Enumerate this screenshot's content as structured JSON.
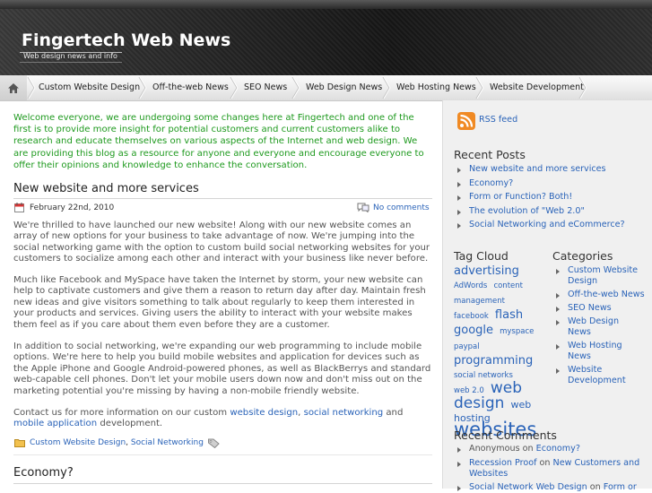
{
  "header": {
    "title": "Fingertech Web News",
    "tagline": "Web design news and info"
  },
  "nav": {
    "items": [
      {
        "label": "Custom Website Design"
      },
      {
        "label": "Off-the-web News"
      },
      {
        "label": "SEO News"
      },
      {
        "label": "Web Design News"
      },
      {
        "label": "Web Hosting News"
      },
      {
        "label": "Website Development"
      }
    ]
  },
  "intro": "Welcome everyone, we are undergoing some changes here at Fingertech and one of the first is to provide more insight for potential customers and current customers alike to research and educate themselves on various aspects of the Internet and web design. We are providing this blog as a resource for anyone and everyone and encourage everyone to offer their opinions and knowledge to enhance the conversation.",
  "posts": [
    {
      "title": "New website and more services",
      "date": "February 22nd, 2010",
      "comments": "No comments",
      "paragraphs": [
        "We're thrilled to have launched our new website! Along with our new website comes an array of new options for your business to take advantage of now. We're jumping into the social networking game with the option to custom build social networking websites for your customers to socialize among each other and interact with your business like never before.",
        "Much like Facebook and MySpace have taken the Internet by storm, your new website can help to captivate customers and give them a reason to return day after day. Maintain fresh new ideas and give visitors something to talk about regularly to keep them interested in your products and services. Giving users the ability to interact with your website makes them feel as if you care about them even before they are a customer.",
        "In addition to social networking, we're expanding our web programming to include mobile options. We're here to help you build mobile websites and application for devices such as the Apple iPhone and Google Android-powered phones, as well as BlackBerrys and standard web-capable cell phones. Don't let your mobile users down now and don't miss out on the marketing potential you're missing by having a non-mobile friendly website."
      ],
      "contact": {
        "before": "Contact us for more information on our custom ",
        "link1": "website design",
        "sep1": ", ",
        "link2": "social networking",
        "sep2": " and ",
        "link3": "mobile application",
        "after": " development."
      },
      "categories": [
        "Custom Website Design",
        "Social Networking"
      ],
      "cat_sep": ", "
    },
    {
      "title": "Economy?"
    }
  ],
  "sidebar": {
    "rss": "RSS feed",
    "recent_posts": {
      "heading": "Recent Posts",
      "items": [
        "New website and more services",
        "Economy?",
        "Form or Function? Both!",
        "The evolution of \"Web 2.0\"",
        "Social Networking and eCommerce?"
      ]
    },
    "tag_cloud": {
      "heading": "Tag Cloud",
      "tags": [
        {
          "label": "advertising",
          "size": 13
        },
        {
          "label": "AdWords",
          "size": 8.5
        },
        {
          "label": "content",
          "size": 8.5
        },
        {
          "label": "management",
          "size": 8.5
        },
        {
          "label": "facebook",
          "size": 8.5
        },
        {
          "label": "flash",
          "size": 13
        },
        {
          "label": "google",
          "size": 13
        },
        {
          "label": "myspace",
          "size": 8.5
        },
        {
          "label": "paypal",
          "size": 8.5
        },
        {
          "label": "programming",
          "size": 13
        },
        {
          "label": "social networks",
          "size": 8.5
        },
        {
          "label": "web 2.0",
          "size": 8.5
        },
        {
          "label": "web design",
          "size": 17
        },
        {
          "label": "web hosting",
          "size": 11
        },
        {
          "label": "websites",
          "size": 21
        }
      ]
    },
    "categories": {
      "heading": "Categories",
      "items": [
        "Custom Website Design",
        "Off-the-web News",
        "SEO News",
        "Web Design News",
        "Web Hosting News",
        "Website Development"
      ]
    },
    "recent_comments": {
      "heading": "Recent Comments",
      "items": [
        {
          "author": "Anonymous",
          "on": " on ",
          "post": "Economy?"
        },
        {
          "author": "Recession Proof",
          "on": " on ",
          "post": "New Customers and Websites"
        },
        {
          "author": "Social Network Web Design",
          "on": " on ",
          "post": "Form or"
        }
      ]
    }
  },
  "colors": {
    "link": "#2a63b8",
    "intro_text": "#1f9a1f",
    "header_bg": "#1c1c1c",
    "sidebar_bg": "#f0f0f0",
    "rss_orange": "#f08a24"
  }
}
